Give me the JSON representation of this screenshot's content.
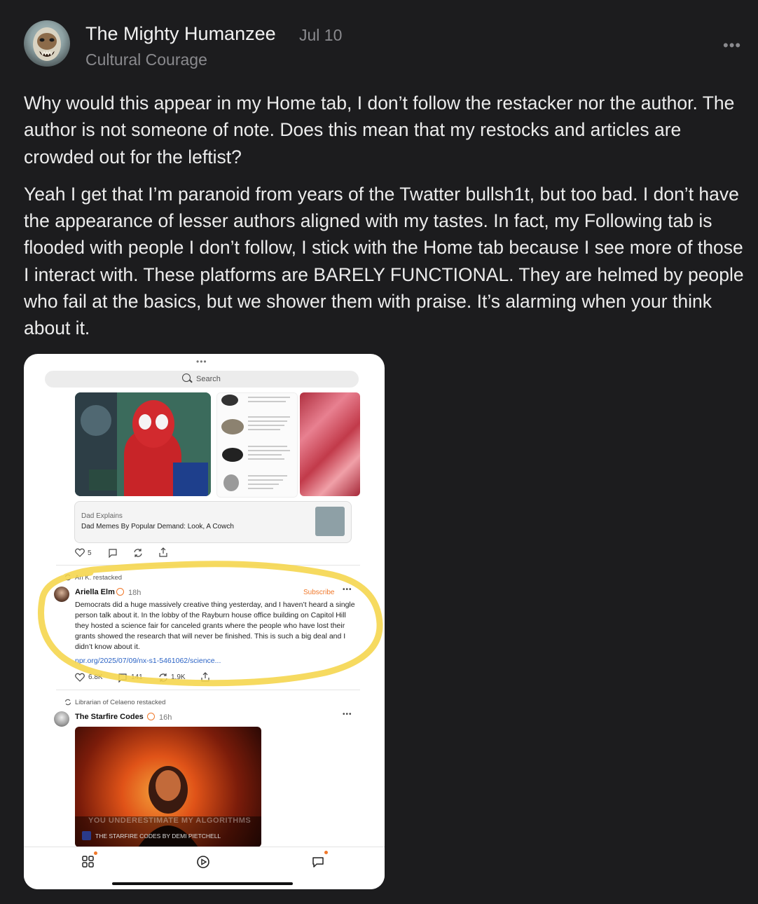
{
  "post": {
    "author": "The Mighty Humanzee",
    "date": "Jul 10",
    "publication": "Cultural Courage",
    "more": "•••",
    "paragraphs": [
      "Why would this appear in my Home tab, I don’t follow the restacker nor the author. The author is not someone of note. Does this mean that my restocks and articles are crowded out for the leftist?",
      "Yeah I get that I’m paranoid from years of the Twatter bullsh1t, but too bad. I don’t have the appearance of lesser authors aligned with my tastes. In fact, my Following tab is flooded with people I don’t follow, I stick with the Home tab because I see more of those I interact with. These platforms are BARELY FUNCTIONAL. They are helmed by people who fail at the basics, but we shower them with praise. It’s alarming when your think about it."
    ]
  },
  "screenshot": {
    "grabber": "•••",
    "search_placeholder": "Search",
    "link_card": {
      "subtitle": "Dad Explains",
      "title": "Dad Memes By Popular Demand: Look, A Cowch"
    },
    "first_actions": {
      "likes": "5"
    },
    "note1": {
      "restacked_by": "An K. restacked",
      "author": "Ariella Elm",
      "time": "18h",
      "subscribe": "Subscribe",
      "text": "Democrats did a huge massively creative thing yesterday, and I haven’t heard a single person talk about it. In the lobby of the Rayburn house office building on Capitol Hill they hosted a science fair for canceled grants where the people who have lost their grants showed the research that will never be finished. This is such a big deal and I didn’t know about it.",
      "link": "npr.org/2025/07/09/nx-s1-5461062/science...",
      "likes": "6.8K",
      "comments": "141",
      "restacks": "1.9K"
    },
    "note2": {
      "restacked_by": "Librarian of Celaeno restacked",
      "author": "The Starfire Codes",
      "time": "16h",
      "video_overlay": "YOU UNDERESTIMATE MY ALGORITHMS",
      "video_caption": "THE STARFIRE CODES BY DEMI PIETCHELL"
    }
  },
  "colors": {
    "highlight": "#f5d54a",
    "accent": "#f0782a",
    "link": "#2b63c5"
  }
}
